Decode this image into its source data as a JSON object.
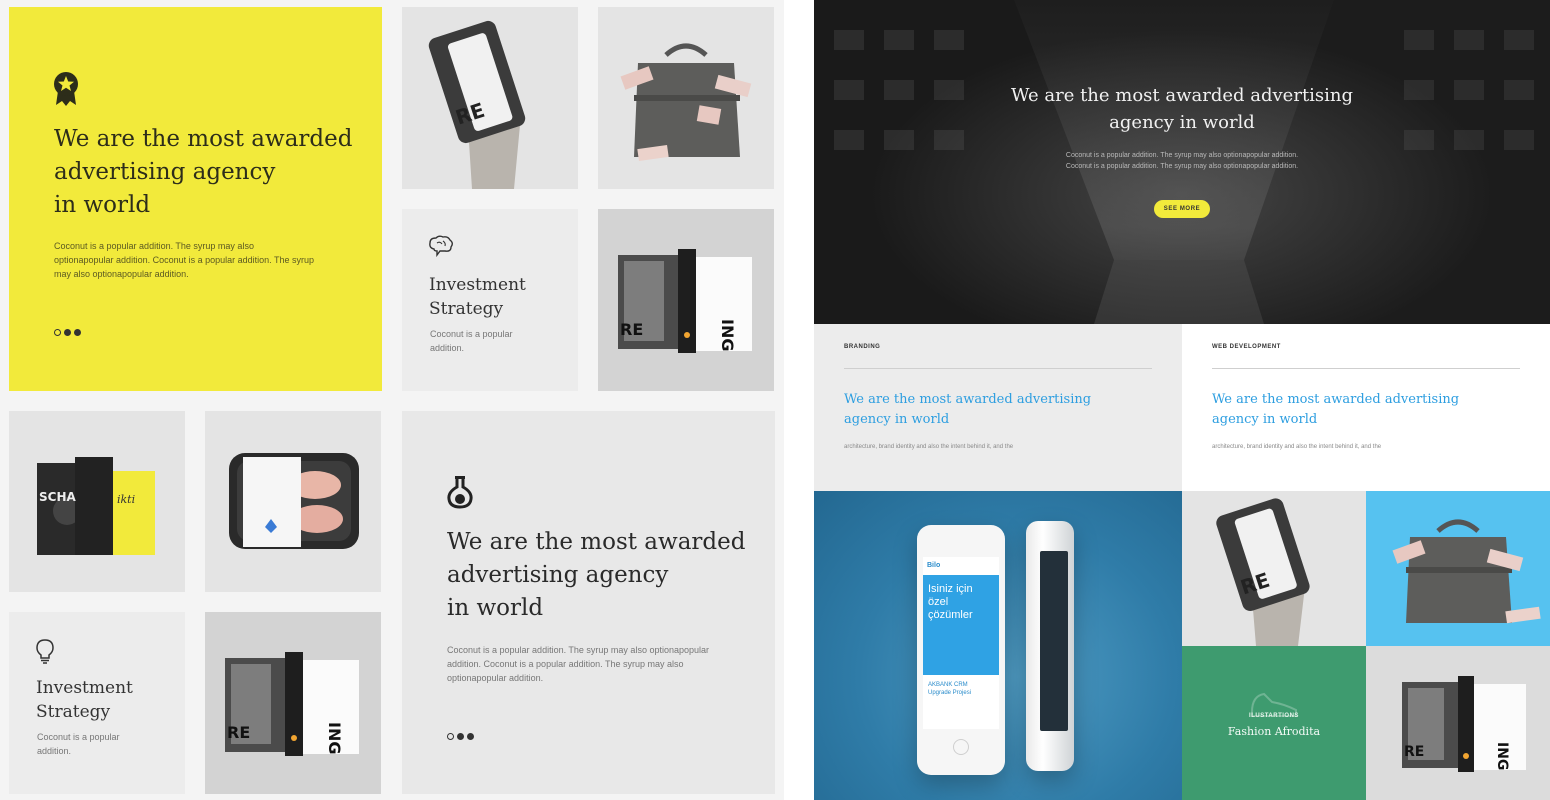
{
  "left": {
    "hero_yellow": {
      "title_lines": [
        "We are the most awarded",
        "advertising agency",
        "in world"
      ],
      "body": "Coconut is a popular addition. The syrup may also optionapopular addition. Coconut is a popular addition. The syrup may also optionapopular addition.",
      "icon": "award-badge-icon"
    },
    "invest_card_1": {
      "title_lines": [
        "Investment",
        "Strategy"
      ],
      "body": "Coconut is a popular addition.",
      "icon": "brain-icon"
    },
    "invest_card_2": {
      "title_lines": [
        "Investment",
        "Strategy"
      ],
      "body": "Coconut is a popular addition.",
      "icon": "lightbulb-icon"
    },
    "hero_grey": {
      "title_lines": [
        "We are the most awarded",
        "advertising agency",
        "in world"
      ],
      "body": "Coconut is a popular addition. The syrup may also optionapopular addition. Coconut is a popular addition. The syrup may also optionapopular addition.",
      "icon": "flask-icon"
    },
    "colors": {
      "yellow": "#f2ea3b",
      "tile_grey": "#e8e8e8"
    }
  },
  "right": {
    "city_hero": {
      "title_lines": [
        "We are the most awarded advertising",
        "agency in world"
      ],
      "body": "Coconut is a popular addition. The syrup may also optionapopular addition. Coconut is a popular addition. The syrup may also optionapopular addition.",
      "button": "SEE MORE"
    },
    "services": [
      {
        "category": "BRANDING",
        "title_lines": [
          "We are the most awarded  advertising",
          "agency  in world"
        ],
        "body": "architecture, brand identity and also the intent behind it, and the"
      },
      {
        "category": "WEB DEVELOPMENT",
        "title_lines": [
          "We are the most awarded  advertising",
          "agency  in world"
        ],
        "body": "architecture, brand identity and also the intent behind it, and the"
      }
    ],
    "phone_screen": {
      "logo": "Bilo",
      "headline_lines": [
        "Isiniz için özel",
        "çözümler"
      ],
      "caption_lines": [
        "AKBANK CRM",
        "Upgrade Projesi"
      ]
    },
    "illustration_card": {
      "category": "ILUSTARTIONS",
      "name": "Fashion Afrodita"
    },
    "colors": {
      "accent_blue": "#2d9ee0",
      "green": "#3e9b6f",
      "sky": "#56c2f0"
    }
  }
}
